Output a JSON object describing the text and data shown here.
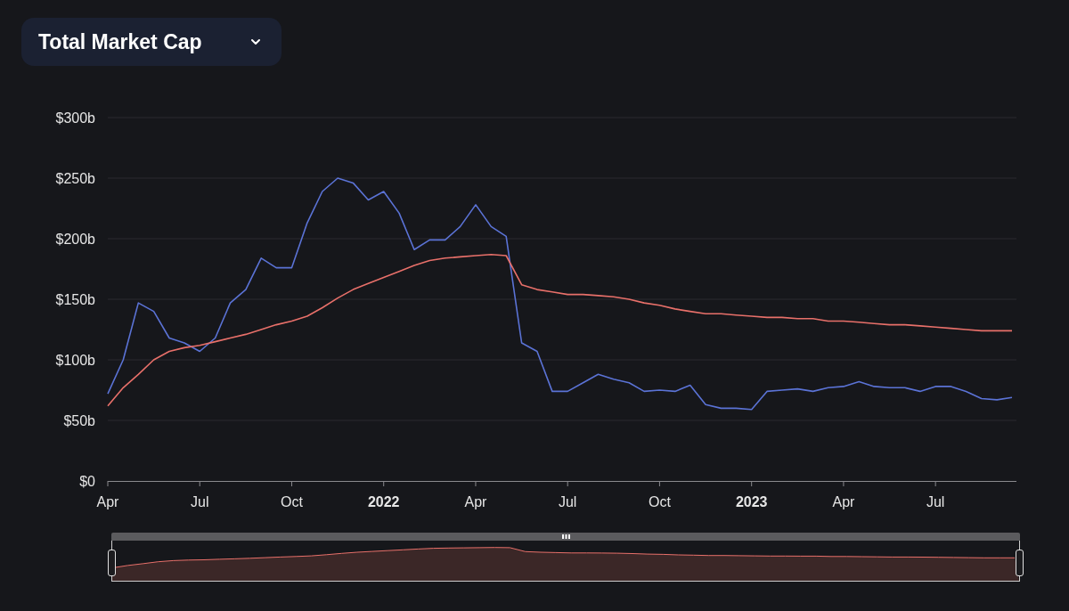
{
  "metric_selector": {
    "label": "Total Market Cap"
  },
  "chart_data": {
    "type": "line",
    "grid": true,
    "x": [
      2021.25,
      2021.292,
      2021.333,
      2021.375,
      2021.417,
      2021.458,
      2021.5,
      2021.542,
      2021.583,
      2021.625,
      2021.667,
      2021.708,
      2021.75,
      2021.792,
      2021.833,
      2021.875,
      2021.917,
      2021.958,
      2022,
      2022.042,
      2022.083,
      2022.125,
      2022.167,
      2022.208,
      2022.25,
      2022.292,
      2022.333,
      2022.375,
      2022.417,
      2022.458,
      2022.5,
      2022.542,
      2022.583,
      2022.625,
      2022.667,
      2022.708,
      2022.75,
      2022.792,
      2022.833,
      2022.875,
      2022.917,
      2022.958,
      2023,
      2023.042,
      2023.083,
      2023.125,
      2023.167,
      2023.208,
      2023.25,
      2023.292,
      2023.333,
      2023.375,
      2023.417,
      2023.458,
      2023.5,
      2023.542,
      2023.583,
      2023.625,
      2023.667,
      2023.708
    ],
    "xlim": [
      2021.25,
      2023.72
    ],
    "series": [
      {
        "color": "#5b73d6",
        "values": [
          72,
          100,
          147,
          140,
          118,
          114,
          107,
          118,
          147,
          158,
          184,
          176,
          176,
          213,
          239,
          250,
          246,
          232,
          239,
          221,
          191,
          199,
          199,
          210,
          228,
          210,
          202,
          114,
          107,
          74,
          74,
          81,
          88,
          84,
          81,
          74,
          75,
          74,
          79,
          63,
          60,
          60,
          59,
          74,
          75,
          76,
          74,
          77,
          78,
          82,
          78,
          77,
          77,
          74,
          78,
          78,
          74,
          68,
          67,
          69
        ]
      },
      {
        "color": "#e8706a",
        "values": [
          62,
          77,
          88,
          100,
          107,
          110,
          112,
          115,
          118,
          121,
          125,
          129,
          132,
          136,
          143,
          151,
          158,
          163,
          168,
          173,
          178,
          182,
          184,
          185,
          186,
          187,
          186,
          162,
          158,
          156,
          154,
          154,
          153,
          152,
          150,
          147,
          145,
          142,
          140,
          138,
          138,
          137,
          136,
          135,
          135,
          134,
          134,
          132,
          132,
          131,
          130,
          129,
          129,
          128,
          127,
          126,
          125,
          124,
          124,
          124
        ]
      }
    ],
    "ylim": [
      0,
      300
    ],
    "yticks": [
      {
        "value": 0,
        "label": "$0"
      },
      {
        "value": 50,
        "label": "$50b"
      },
      {
        "value": 100,
        "label": "$100b"
      },
      {
        "value": 150,
        "label": "$150b"
      },
      {
        "value": 200,
        "label": "$200b"
      },
      {
        "value": 250,
        "label": "$250b"
      },
      {
        "value": 300,
        "label": "$300b"
      }
    ],
    "xticks": [
      {
        "value": 2021.25,
        "label": "Apr"
      },
      {
        "value": 2021.5,
        "label": "Jul"
      },
      {
        "value": 2021.75,
        "label": "Oct"
      },
      {
        "value": 2022,
        "label": "2022"
      },
      {
        "value": 2022.25,
        "label": "Apr"
      },
      {
        "value": 2022.5,
        "label": "Jul"
      },
      {
        "value": 2022.75,
        "label": "Oct"
      },
      {
        "value": 2023,
        "label": "2023"
      },
      {
        "value": 2023.25,
        "label": "Apr"
      },
      {
        "value": 2023.5,
        "label": "Jul"
      }
    ]
  }
}
